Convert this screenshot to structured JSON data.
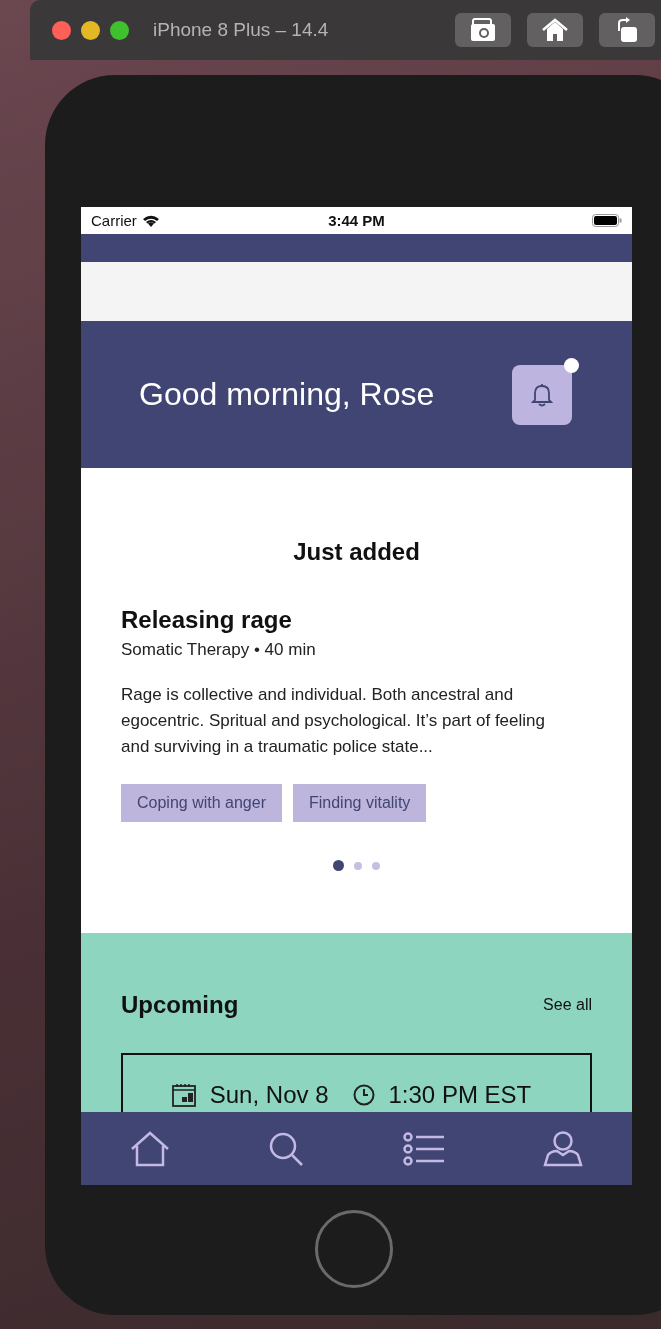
{
  "simulator": {
    "title": "iPhone 8 Plus – 14.4"
  },
  "status_bar": {
    "carrier": "Carrier",
    "time": "3:44 PM"
  },
  "header": {
    "greeting": "Good morning, Rose",
    "notification": {
      "unread": true
    }
  },
  "just_added": {
    "title": "Just added",
    "item": {
      "title": "Releasing rage",
      "meta": "Somatic Therapy • 40 min",
      "description": "Rage is collective and individual. Both ancestral and egocentric. Spritual and psychological. It’s part of feeling and surviving in a traumatic police state...",
      "tags": [
        "Coping with anger",
        "Finding vitality"
      ]
    },
    "pager": [
      {
        "selected": true
      },
      {
        "selected": false
      },
      {
        "selected": false
      }
    ]
  },
  "upcoming": {
    "title": "Upcoming",
    "see_all": "See all",
    "event": {
      "date": "Sun, Nov 8",
      "time": "1:30 PM EST"
    }
  },
  "tab_bar": [
    {
      "kind": "home"
    },
    {
      "kind": "search"
    },
    {
      "kind": "list"
    },
    {
      "kind": "profile"
    }
  ]
}
